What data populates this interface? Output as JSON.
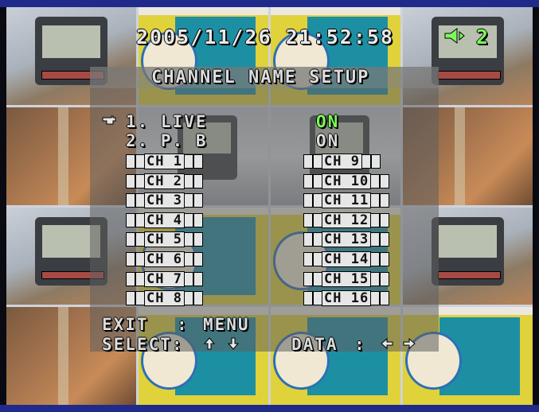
{
  "datetime": "2005/11/26  21:52:58",
  "channel_number": "2",
  "icons": {
    "audio": "speaker-icon",
    "cursor": "hand-pointer-icon",
    "up": "up-arrow-icon",
    "down": "down-arrow-icon",
    "left": "left-arrow-icon",
    "right": "right-arrow-icon"
  },
  "colors": {
    "accent_on": "#7cfa5a",
    "border_bar": "#1f2a8a",
    "osd_text": "#dcdcdc"
  },
  "menu": {
    "title": "CHANNEL NAME SETUP",
    "items": [
      {
        "label": "1. LIVE",
        "value": "ON"
      },
      {
        "label": "2. P. B",
        "value": "ON"
      }
    ],
    "channels_left": [
      "CH 1",
      "CH 2",
      "CH 3",
      "CH 4",
      "CH 5",
      "CH 6",
      "CH 7",
      "CH 8"
    ],
    "channels_right": [
      "CH 9",
      "CH 10",
      "CH 11",
      "CH 12",
      "CH 13",
      "CH 14",
      "CH 15",
      "CH 16"
    ],
    "footer": {
      "exit_label": "EXIT",
      "exit_sep": ":",
      "exit_value": "MENU",
      "select_label": "SELECT:",
      "data_label": "DATA",
      "data_sep": ":"
    }
  }
}
